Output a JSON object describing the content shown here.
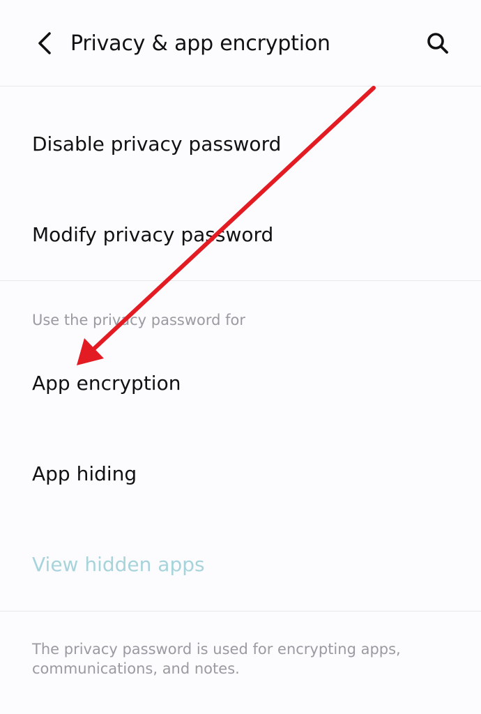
{
  "header": {
    "back_icon": "chevron-left-icon",
    "title": "Privacy & app encryption",
    "search_icon": "search-icon"
  },
  "password_section": {
    "items": [
      {
        "label": "Disable privacy password"
      },
      {
        "label": "Modify privacy password"
      }
    ]
  },
  "usage_section": {
    "header": "Use the privacy password for",
    "items": [
      {
        "label": "App encryption"
      },
      {
        "label": "App hiding"
      },
      {
        "label": "View hidden apps",
        "enabled": false
      }
    ]
  },
  "footer": {
    "note": "The privacy password is used for encrypting apps, communications, and notes."
  },
  "annotation": {
    "arrow_color": "#e31b23"
  }
}
